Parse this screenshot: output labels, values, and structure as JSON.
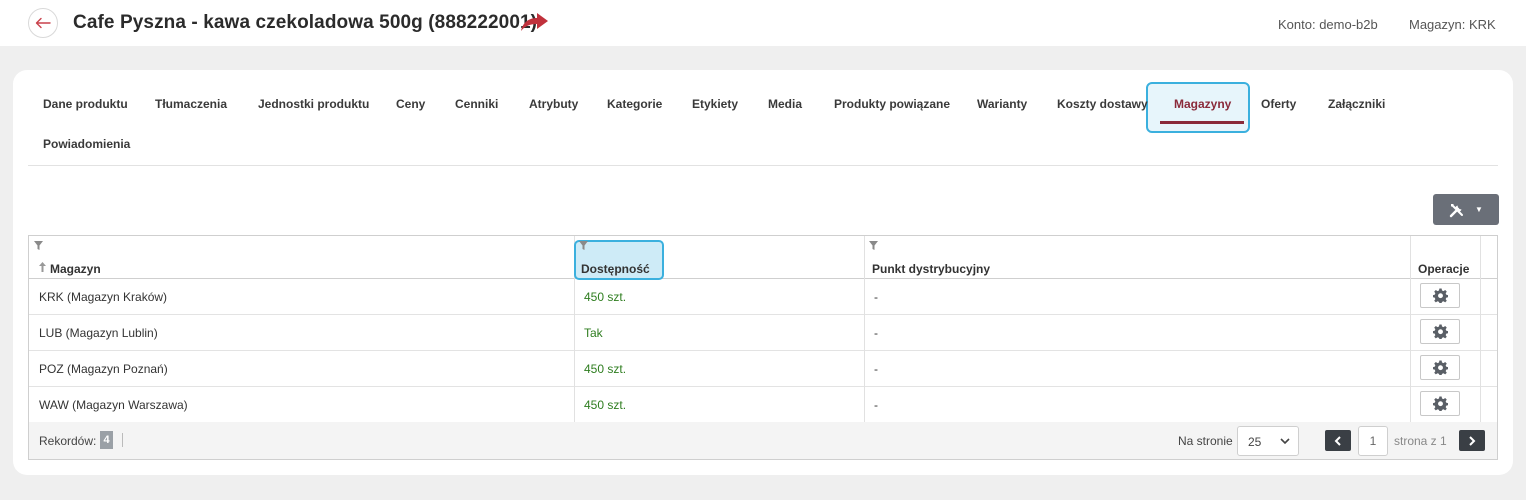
{
  "header": {
    "title": "Cafe Pyszna - kawa czekoladowa 500g (888222001)",
    "account": "Konto: demo-b2b",
    "warehouse": "Magazyn: KRK"
  },
  "tabs": [
    {
      "label": "Dane produktu"
    },
    {
      "label": "Tłumaczenia"
    },
    {
      "label": "Jednostki produktu"
    },
    {
      "label": "Ceny"
    },
    {
      "label": "Cenniki"
    },
    {
      "label": "Atrybuty"
    },
    {
      "label": "Kategorie"
    },
    {
      "label": "Etykiety"
    },
    {
      "label": "Media"
    },
    {
      "label": "Produkty powiązane"
    },
    {
      "label": "Warianty"
    },
    {
      "label": "Koszty dostawy"
    },
    {
      "label": "Magazyny",
      "active": true
    },
    {
      "label": "Oferty"
    },
    {
      "label": "Załączniki"
    },
    {
      "label": "Powiadomienia"
    }
  ],
  "table": {
    "columns": [
      "Magazyn",
      "Dostępność",
      "Punkt dystrybucyjny",
      "Operacje"
    ],
    "rows": [
      {
        "warehouse": "KRK (Magazyn Kraków)",
        "availability": "450 szt.",
        "point": "-"
      },
      {
        "warehouse": "LUB (Magazyn Lublin)",
        "availability": "Tak",
        "point": "-"
      },
      {
        "warehouse": "POZ (Magazyn Poznań)",
        "availability": "450 szt.",
        "point": "-"
      },
      {
        "warehouse": "WAW (Magazyn Warszawa)",
        "availability": "450 szt.",
        "point": "-"
      }
    ]
  },
  "footer": {
    "records_label": "Rekordów:",
    "records_count": "4",
    "per_page_label": "Na stronie",
    "per_page_value": "25",
    "page_value": "1",
    "page_of": "strona z 1"
  },
  "colors": {
    "accent": "#8a2a3a",
    "highlight": "#3bb0de",
    "availability": "#2e7d1f",
    "dark_button": "#3a3f45"
  },
  "icons": {
    "back": "arrow-left-icon",
    "share": "share-arrow-icon",
    "tools": "tools-icon",
    "filter": "filter-icon",
    "sort": "sort-up-icon",
    "gear": "gear-icon",
    "prev": "chevron-left-icon",
    "next": "chevron-right-icon"
  }
}
